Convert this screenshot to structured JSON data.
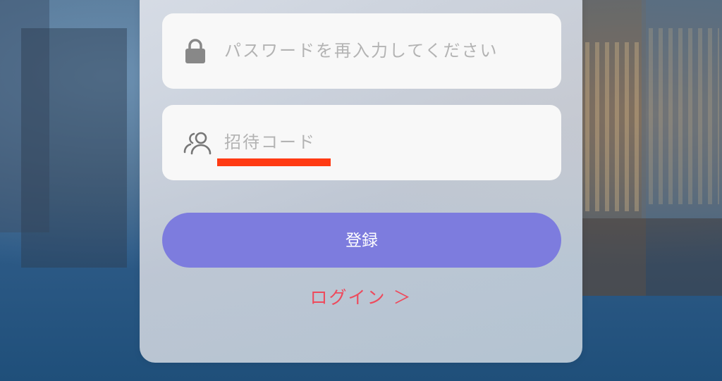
{
  "form": {
    "password_confirm": {
      "placeholder": "パスワードを再入力してください",
      "icon": "lock-icon"
    },
    "invite_code": {
      "placeholder": "招待コード",
      "icon": "users-icon"
    },
    "register_label": "登録",
    "login_link_label": "ログイン ＞"
  },
  "colors": {
    "primary_button": "#7d7cde",
    "link": "#ee4a5c",
    "highlight_mark": "#ff3b14",
    "placeholder_text": "#b3b3b3"
  }
}
